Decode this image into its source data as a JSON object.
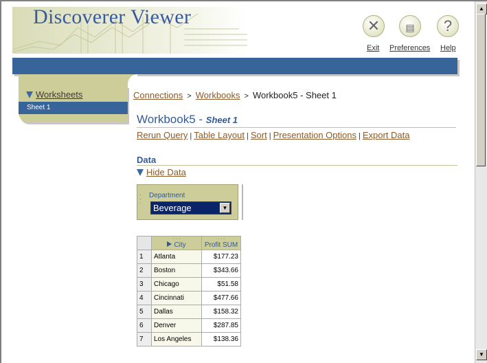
{
  "app": {
    "title": "Discoverer Viewer"
  },
  "global_links": [
    {
      "label": "Exit",
      "icon": "exit-icon"
    },
    {
      "label": "Preferences",
      "icon": "preferences-icon"
    },
    {
      "label": "Help",
      "icon": "help-icon"
    }
  ],
  "sidebar": {
    "header": "Worksheets",
    "items": [
      {
        "label": "Sheet 1",
        "selected": true
      }
    ]
  },
  "breadcrumb": {
    "connections": "Connections",
    "workbooks": "Workbooks",
    "current": "Workbook5 - Sheet 1",
    "separator": ">"
  },
  "workbook": {
    "name": "Workbook5 -",
    "sheet": "Sheet 1"
  },
  "actions": [
    "Rerun Query",
    "Table Layout",
    "Sort",
    "Presentation Options",
    "Export Data"
  ],
  "data_section": {
    "heading": "Data",
    "toggle": "Hide Data",
    "page_item": {
      "label": "Department",
      "value": "Beverage"
    },
    "table": {
      "columns": [
        "City",
        "Profit SUM"
      ],
      "rows": [
        {
          "n": "1",
          "city": "Atlanta",
          "profit": "$177.23"
        },
        {
          "n": "2",
          "city": "Boston",
          "profit": "$343.66"
        },
        {
          "n": "3",
          "city": "Chicago",
          "profit": "$51.58"
        },
        {
          "n": "4",
          "city": "Cincinnati",
          "profit": "$477.66"
        },
        {
          "n": "5",
          "city": "Dallas",
          "profit": "$158.32"
        },
        {
          "n": "6",
          "city": "Denver",
          "profit": "$287.85"
        },
        {
          "n": "7",
          "city": "Los Angeles",
          "profit": "$138.36"
        }
      ]
    }
  },
  "colors": {
    "accent_blue": "#376599",
    "tan": "#cdcd9a",
    "link_brown": "#8a5a2a"
  }
}
